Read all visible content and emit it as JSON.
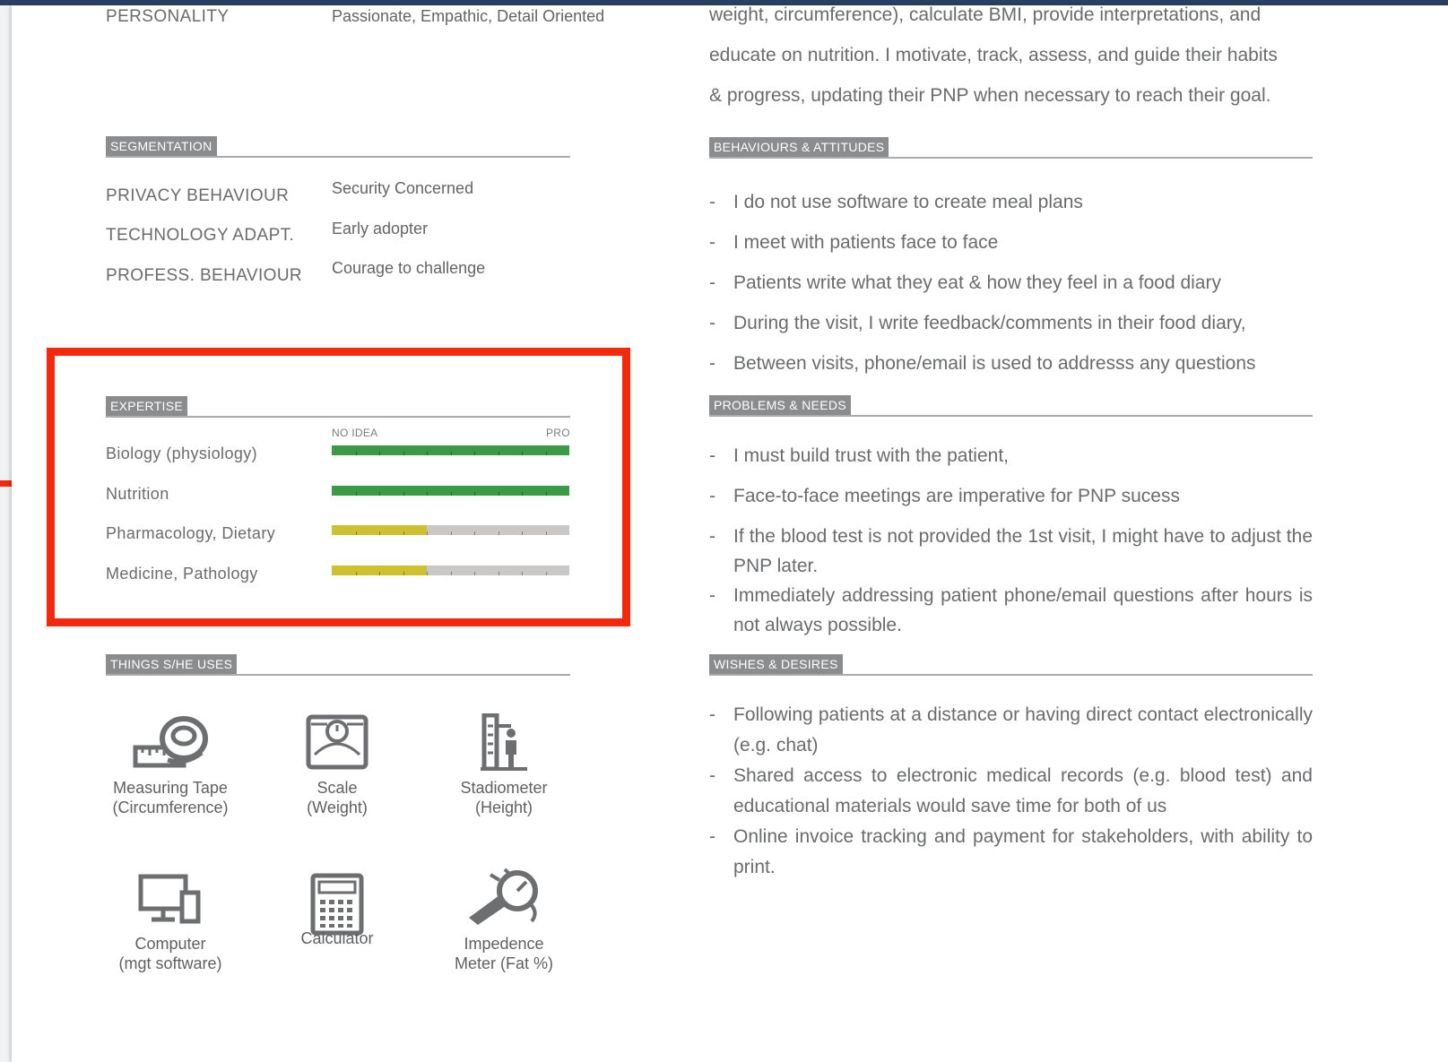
{
  "persona": {
    "personality_label": "PERSONALITY",
    "personality_value": "Passionate, Empathic, Detail Oriented"
  },
  "intro": {
    "lines": [
      "weight, circumference), calculate BMI, provide interpretations, and",
      "educate on nutrition. I motivate, track, assess, and guide their habits",
      "& progress, updating their PNP when necessary to reach their goal."
    ]
  },
  "segmentation": {
    "title": "SEGMENTATION",
    "rows": [
      {
        "label": "PRIVACY BEHAVIOUR",
        "value": "Security Concerned"
      },
      {
        "label": "TECHNOLOGY ADAPT.",
        "value": "Early adopter"
      },
      {
        "label": "PROFESS. BEHAVIOUR",
        "value": "Courage to challenge"
      }
    ]
  },
  "expertise": {
    "title": "EXPERTISE",
    "scale_min": "NO IDEA",
    "scale_max": "PRO",
    "rows": [
      {
        "label": "Biology (physiology)",
        "level": 1.0,
        "color": "#3a9a46"
      },
      {
        "label": "Nutrition",
        "level": 1.0,
        "color": "#3a9a46"
      },
      {
        "label": "Pharmacology, Dietary",
        "level": 0.4,
        "color": "#cfc02e"
      },
      {
        "label": "Medicine, Pathology",
        "level": 0.4,
        "color": "#cfc02e"
      }
    ]
  },
  "things": {
    "title": "THINGS S/HE USES",
    "items": [
      {
        "icon": "measuring-tape-icon",
        "line1": "Measuring Tape",
        "line2": "(Circumference)"
      },
      {
        "icon": "scale-icon",
        "line1": "Scale",
        "line2": "(Weight)"
      },
      {
        "icon": "stadiometer-icon",
        "line1": "Stadiometer",
        "line2": "(Height)"
      },
      {
        "icon": "computer-icon",
        "line1": "Computer",
        "line2": "(mgt software)"
      },
      {
        "icon": "calculator-icon",
        "line1": "Calculator",
        "line2": ""
      },
      {
        "icon": "impedence-meter-icon",
        "line1": "Impedence",
        "line2": "Meter (Fat %)"
      }
    ]
  },
  "behaviours": {
    "title": "BEHAVIOURS & ATTITUDES",
    "items": [
      "I do not use software to create meal plans",
      "I meet with patients face to face",
      "Patients write what they eat & how they feel in a food diary",
      "During the visit, I write feedback/comments in their food diary,",
      "Between visits, phone/email is used to addresss any questions"
    ]
  },
  "problems": {
    "title": "PROBLEMS & NEEDS",
    "items": [
      "I must build trust with the patient,",
      "Face-to-face meetings are imperative for PNP sucess",
      "If the blood test is not provided the 1st visit, I might have to adjust the PNP later.",
      "Immediately addressing patient phone/email questions after hours is not always possible."
    ]
  },
  "wishes": {
    "title": "WISHES & DESIRES",
    "items": [
      "Following patients at a distance or having direct contact electronically (e.g. chat)",
      "Shared access to electronic medical records (e.g. blood test) and educational materials would save time for both of us",
      "Online invoice tracking and payment for stakeholders, with ability to print."
    ]
  },
  "colors": {
    "highlight": "#f3290d",
    "section_tag": "#8b8c8e",
    "bar_empty": "#c9c8c6"
  }
}
